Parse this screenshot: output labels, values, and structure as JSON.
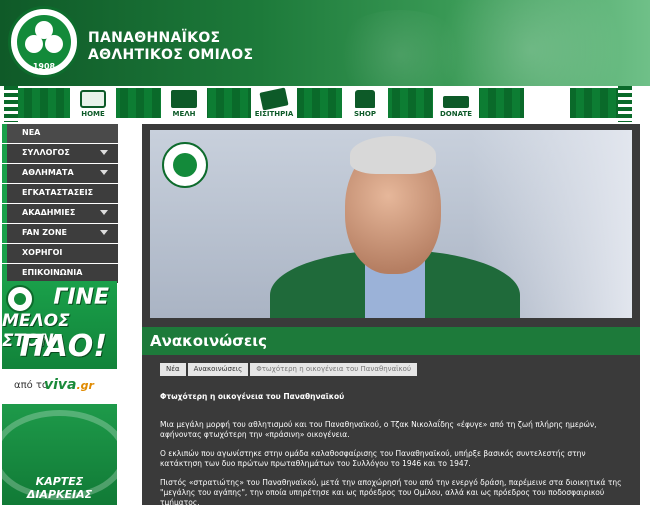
{
  "header": {
    "logo_text": "ΠΑΝΑΘΗΝΑΪΚΟΣ Α.Ο.",
    "logo_year": "1908",
    "title_line1": "ΠΑΝΑΘΗΝΑΪΚΟΣ",
    "title_line2": "ΑΘΛΗΤΙΚΟΣ ΟΜΙΛΟΣ"
  },
  "nav": {
    "items": [
      {
        "label": "HOME",
        "icon": "stadium-icon"
      },
      {
        "label": "ΜΕΛΗ",
        "icon": "member-card-icon"
      },
      {
        "label": "ΕΙΣΙΤΗΡΙΑ",
        "icon": "ticket-icon"
      },
      {
        "label": "SHOP",
        "icon": "jersey-icon"
      },
      {
        "label": "DONATE",
        "icon": "donate-icon"
      },
      {
        "label": "",
        "icon": "blank"
      }
    ]
  },
  "sidebar": {
    "items": [
      {
        "label": "ΝΕΑ",
        "has_arrow": false
      },
      {
        "label": "ΣΥΛΛΟΓΟΣ",
        "has_arrow": true
      },
      {
        "label": "ΑΘΛΗΜΑΤΑ",
        "has_arrow": true
      },
      {
        "label": "ΕΓΚΑΤΑΣΤΑΣΕΙΣ",
        "has_arrow": false
      },
      {
        "label": "ΑΚΑΔΗΜΙΕΣ",
        "has_arrow": true
      },
      {
        "label": "FAN ZONE",
        "has_arrow": true
      },
      {
        "label": "ΧΟΡΗΓΟΙ",
        "has_arrow": false
      },
      {
        "label": "ΕΠΙΚΟΙΝΩΝΙΑ",
        "has_arrow": false
      }
    ]
  },
  "banner_membership": {
    "line1": "ΓΙΝΕ",
    "line2": "ΜΕΛΟΣ ΣΤΟΝ",
    "line3": "ΠΑΟ!",
    "from_label": "από το",
    "brand": "viva",
    "brand_suffix": ".gr"
  },
  "banner_season": {
    "text": "ΚΑΡΤΕΣ ΔΙΑΡΚΕΙΑΣ"
  },
  "main": {
    "section_title": "Ανακοινώσεις",
    "breadcrumbs": [
      "Νέα",
      "Ανακοινώσεις",
      "Φτωχότερη η οικογένεια του Παναθηναϊκού"
    ],
    "article_title": "Φτωχότερη η οικογένεια του Παναθηναϊκού",
    "paragraphs": [
      "Μια μεγάλη μορφή του αθλητισμού και του Παναθηναϊκού, ο  Τζακ Νικολαΐδης «έφυγε» από τη ζωή πλήρης ημερών, αφήνοντας φτωχότερη την «πράσινη» οικογένεια.",
      "Ο εκλιπών που αγωνίστηκε στην ομάδα καλαθοσφαίρισης του Παναθηναϊκού, υπήρξε βασικός συντελεστής στην κατάκτηση των δυο πρώτων πρωταθλημάτων του Συλλόγου το 1946 και το 1947.",
      "Πιστός «στρατιώτης» του Παναθηναϊκού, μετά την αποχώρησή του από την ενεργό δράση, παρέμεινε στα διοικητικά της \"μεγάλης του αγάπης\", την οποία υπηρέτησε και ως πρόεδρος του Ομίλου, αλλά και ως πρόεδρος του ποδοσφαιρικού τμήματος,"
    ]
  }
}
